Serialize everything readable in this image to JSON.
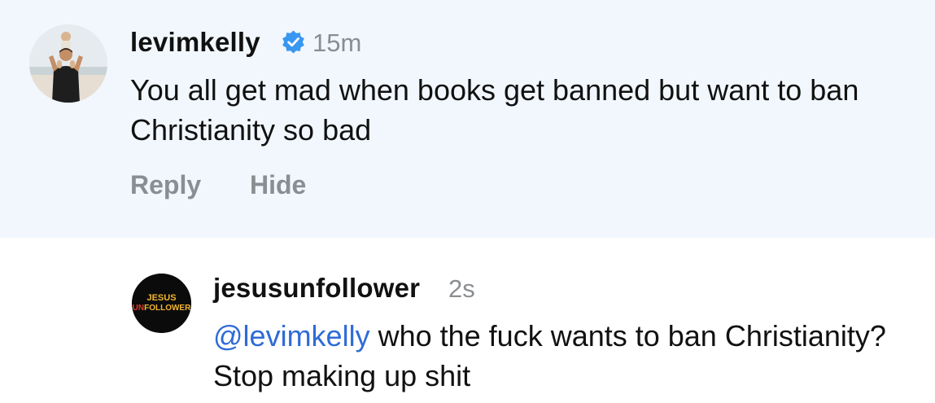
{
  "comment": {
    "username": "levimkelly",
    "verified": true,
    "time": "15m",
    "text": "You all get mad when books get banned but want to ban Christianity so bad",
    "actions": {
      "reply_label": "Reply",
      "hide_label": "Hide"
    },
    "background_color": "#f1f7fd"
  },
  "reply": {
    "username": "jesusunfollower",
    "time": "2s",
    "mention": "@levimkelly",
    "text": " who the fuck wants to ban Christianity? Stop making up shit",
    "avatar_logo_line1": "JESUS",
    "avatar_logo_line2_prefix": "UN",
    "avatar_logo_line2_suffix": "FOLLOWER"
  },
  "colors": {
    "mention": "#2f6bd6",
    "verified_badge": "#3897f0",
    "muted_text": "#8a8d91"
  }
}
